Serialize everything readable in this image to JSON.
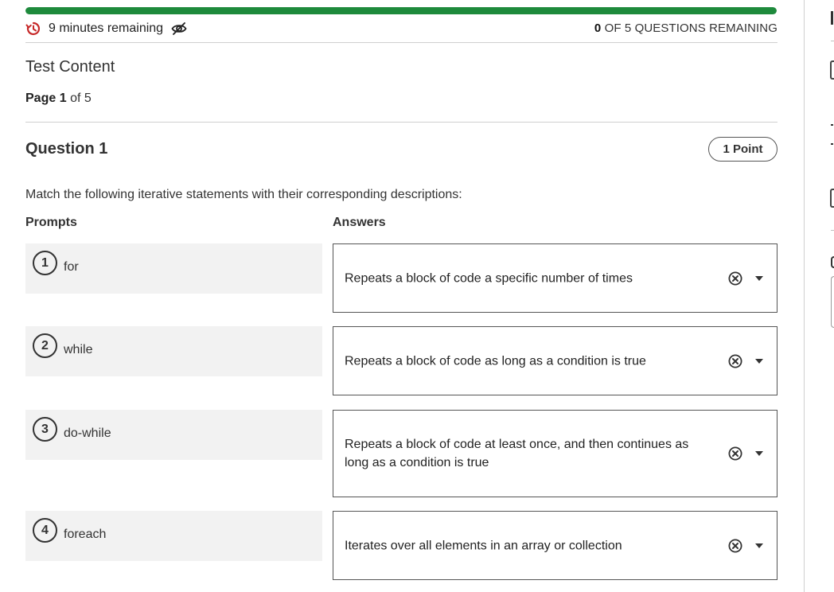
{
  "progress": {
    "fraction": 1.0,
    "color": "#1e8a3c"
  },
  "timer": {
    "text": "9 minutes remaining",
    "icon": "timer-icon",
    "hide_icon": "eye-slash-icon",
    "icon_color": "#c62828"
  },
  "questions_remaining": {
    "count": "0",
    "label": "OF 5 QUESTIONS REMAINING"
  },
  "test": {
    "title": "Test Content",
    "page_label": "Page",
    "page_current": "1",
    "page_total_text": "of 5"
  },
  "question": {
    "title": "Question 1",
    "points": "1 Point",
    "instructions": "Match the following iterative statements with their corresponding descriptions:",
    "prompts_header": "Prompts",
    "answers_header": "Answers",
    "pairs": [
      {
        "number": "1",
        "prompt": "for",
        "answer": "Repeats a block of code a specific number of times"
      },
      {
        "number": "2",
        "prompt": "while",
        "answer": "Repeats a block of code as long as a condition is true"
      },
      {
        "number": "3",
        "prompt": "do-while",
        "answer": "Repeats a block of code at least once, and then continues as long as a condition is true"
      },
      {
        "number": "4",
        "prompt": "foreach",
        "answer": "Iterates over all elements in an array or collection"
      }
    ]
  },
  "icons": {
    "clear": "clear-circle-icon",
    "dropdown": "caret-down-icon"
  }
}
